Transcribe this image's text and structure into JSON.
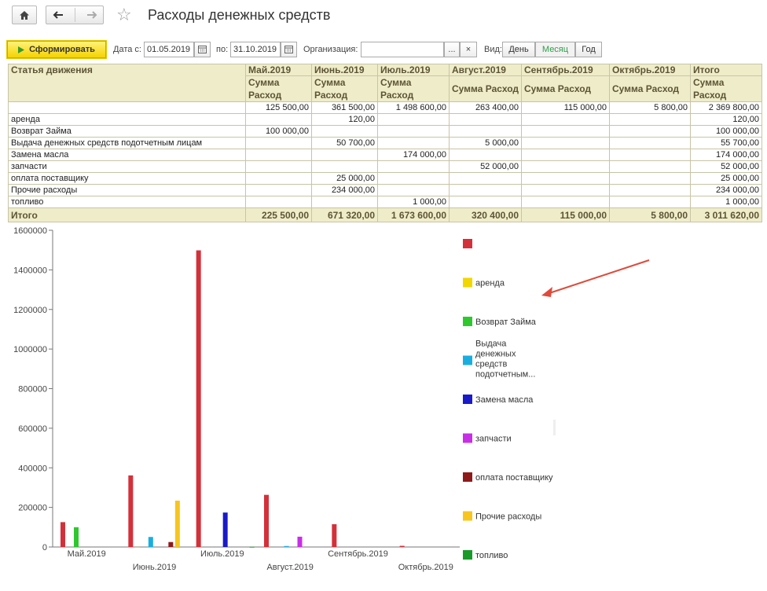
{
  "header": {
    "title": "Расходы денежных средств",
    "home_icon": "home-icon",
    "back_icon": "arrow-left-icon",
    "forward_icon": "arrow-right-icon",
    "favorite_icon": "star-icon"
  },
  "toolbar": {
    "generate_label": "Сформировать",
    "date_from_label": "Дата с:",
    "date_from_value": "01.05.2019",
    "date_to_label": "по:",
    "date_to_value": "31.10.2019",
    "org_label": "Организация:",
    "org_value": "",
    "org_select_label": "...",
    "org_clear_label": "×",
    "view_label": "Вид:",
    "view_options": [
      "День",
      "Месяц",
      "Год"
    ],
    "view_selected": "Месяц",
    "accent_color": "#2e9e4a"
  },
  "table": {
    "item_header": "Статья движения",
    "months": [
      "Май.2019",
      "Июнь.2019",
      "Июль.2019",
      "Август.2019",
      "Сентябрь.2019",
      "Октябрь.2019",
      "Итого"
    ],
    "subheader": "Сумма Расход",
    "rows": [
      {
        "name": "",
        "values": [
          "125 500,00",
          "361 500,00",
          "1 498 600,00",
          "263 400,00",
          "115 000,00",
          "5 800,00",
          "2 369 800,00"
        ]
      },
      {
        "name": "аренда",
        "values": [
          "",
          "120,00",
          "",
          "",
          "",
          "",
          "120,00"
        ]
      },
      {
        "name": "Возврат Займа",
        "values": [
          "100 000,00",
          "",
          "",
          "",
          "",
          "",
          "100 000,00"
        ]
      },
      {
        "name": "Выдача денежных средств подотчетным лицам",
        "values": [
          "",
          "50 700,00",
          "",
          "5 000,00",
          "",
          "",
          "55 700,00"
        ]
      },
      {
        "name": "Замена масла",
        "values": [
          "",
          "",
          "174 000,00",
          "",
          "",
          "",
          "174 000,00"
        ]
      },
      {
        "name": "запчасти",
        "values": [
          "",
          "",
          "",
          "52 000,00",
          "",
          "",
          "52 000,00"
        ]
      },
      {
        "name": "оплата поставщику",
        "values": [
          "",
          "25 000,00",
          "",
          "",
          "",
          "",
          "25 000,00"
        ]
      },
      {
        "name": "Прочие расходы",
        "values": [
          "",
          "234 000,00",
          "",
          "",
          "",
          "",
          "234 000,00"
        ]
      },
      {
        "name": "топливо",
        "values": [
          "",
          "",
          "1 000,00",
          "",
          "",
          "",
          "1 000,00"
        ]
      }
    ],
    "total": {
      "name": "Итого",
      "values": [
        "225 500,00",
        "671 320,00",
        "1 673 600,00",
        "320 400,00",
        "115 000,00",
        "5 800,00",
        "3 011 620,00"
      ]
    }
  },
  "chart_data": {
    "type": "bar",
    "categories": [
      "Май.2019",
      "Июнь.2019",
      "Июль.2019",
      "Август.2019",
      "Сентябрь.2019",
      "Октябрь.2019"
    ],
    "ylim": [
      0,
      1600000
    ],
    "yticks": [
      "0",
      "200000",
      "400000",
      "600000",
      "800000",
      "1000000",
      "1200000",
      "1400000",
      "1600000"
    ],
    "legend_position": "right",
    "grid": false,
    "series": [
      {
        "name": "",
        "color": "#d4303a",
        "values": [
          125500,
          361500,
          1498600,
          263400,
          115000,
          5800
        ]
      },
      {
        "name": "аренда",
        "color": "#f2d600",
        "values": [
          0,
          120,
          0,
          0,
          0,
          0
        ]
      },
      {
        "name": "Возврат Займа",
        "color": "#2ec82e",
        "values": [
          100000,
          0,
          0,
          0,
          0,
          0
        ]
      },
      {
        "name": "Выдача денежных средств подотчетным...",
        "color": "#1aaee0",
        "values": [
          0,
          50700,
          0,
          5000,
          0,
          0
        ]
      },
      {
        "name": "Замена масла",
        "color": "#1a1ac8",
        "values": [
          0,
          0,
          174000,
          0,
          0,
          0
        ]
      },
      {
        "name": "запчасти",
        "color": "#c82ee6",
        "values": [
          0,
          0,
          0,
          52000,
          0,
          0
        ]
      },
      {
        "name": "оплата поставщику",
        "color": "#8e1a1a",
        "values": [
          0,
          25000,
          0,
          0,
          0,
          0
        ]
      },
      {
        "name": "Прочие расходы",
        "color": "#f7c51e",
        "values": [
          0,
          234000,
          0,
          0,
          0,
          0
        ]
      },
      {
        "name": "топливо",
        "color": "#1a9a2a",
        "values": [
          0,
          0,
          1000,
          0,
          0,
          0
        ]
      }
    ]
  },
  "annotation": {
    "arrow_color": "#e04a3a"
  }
}
